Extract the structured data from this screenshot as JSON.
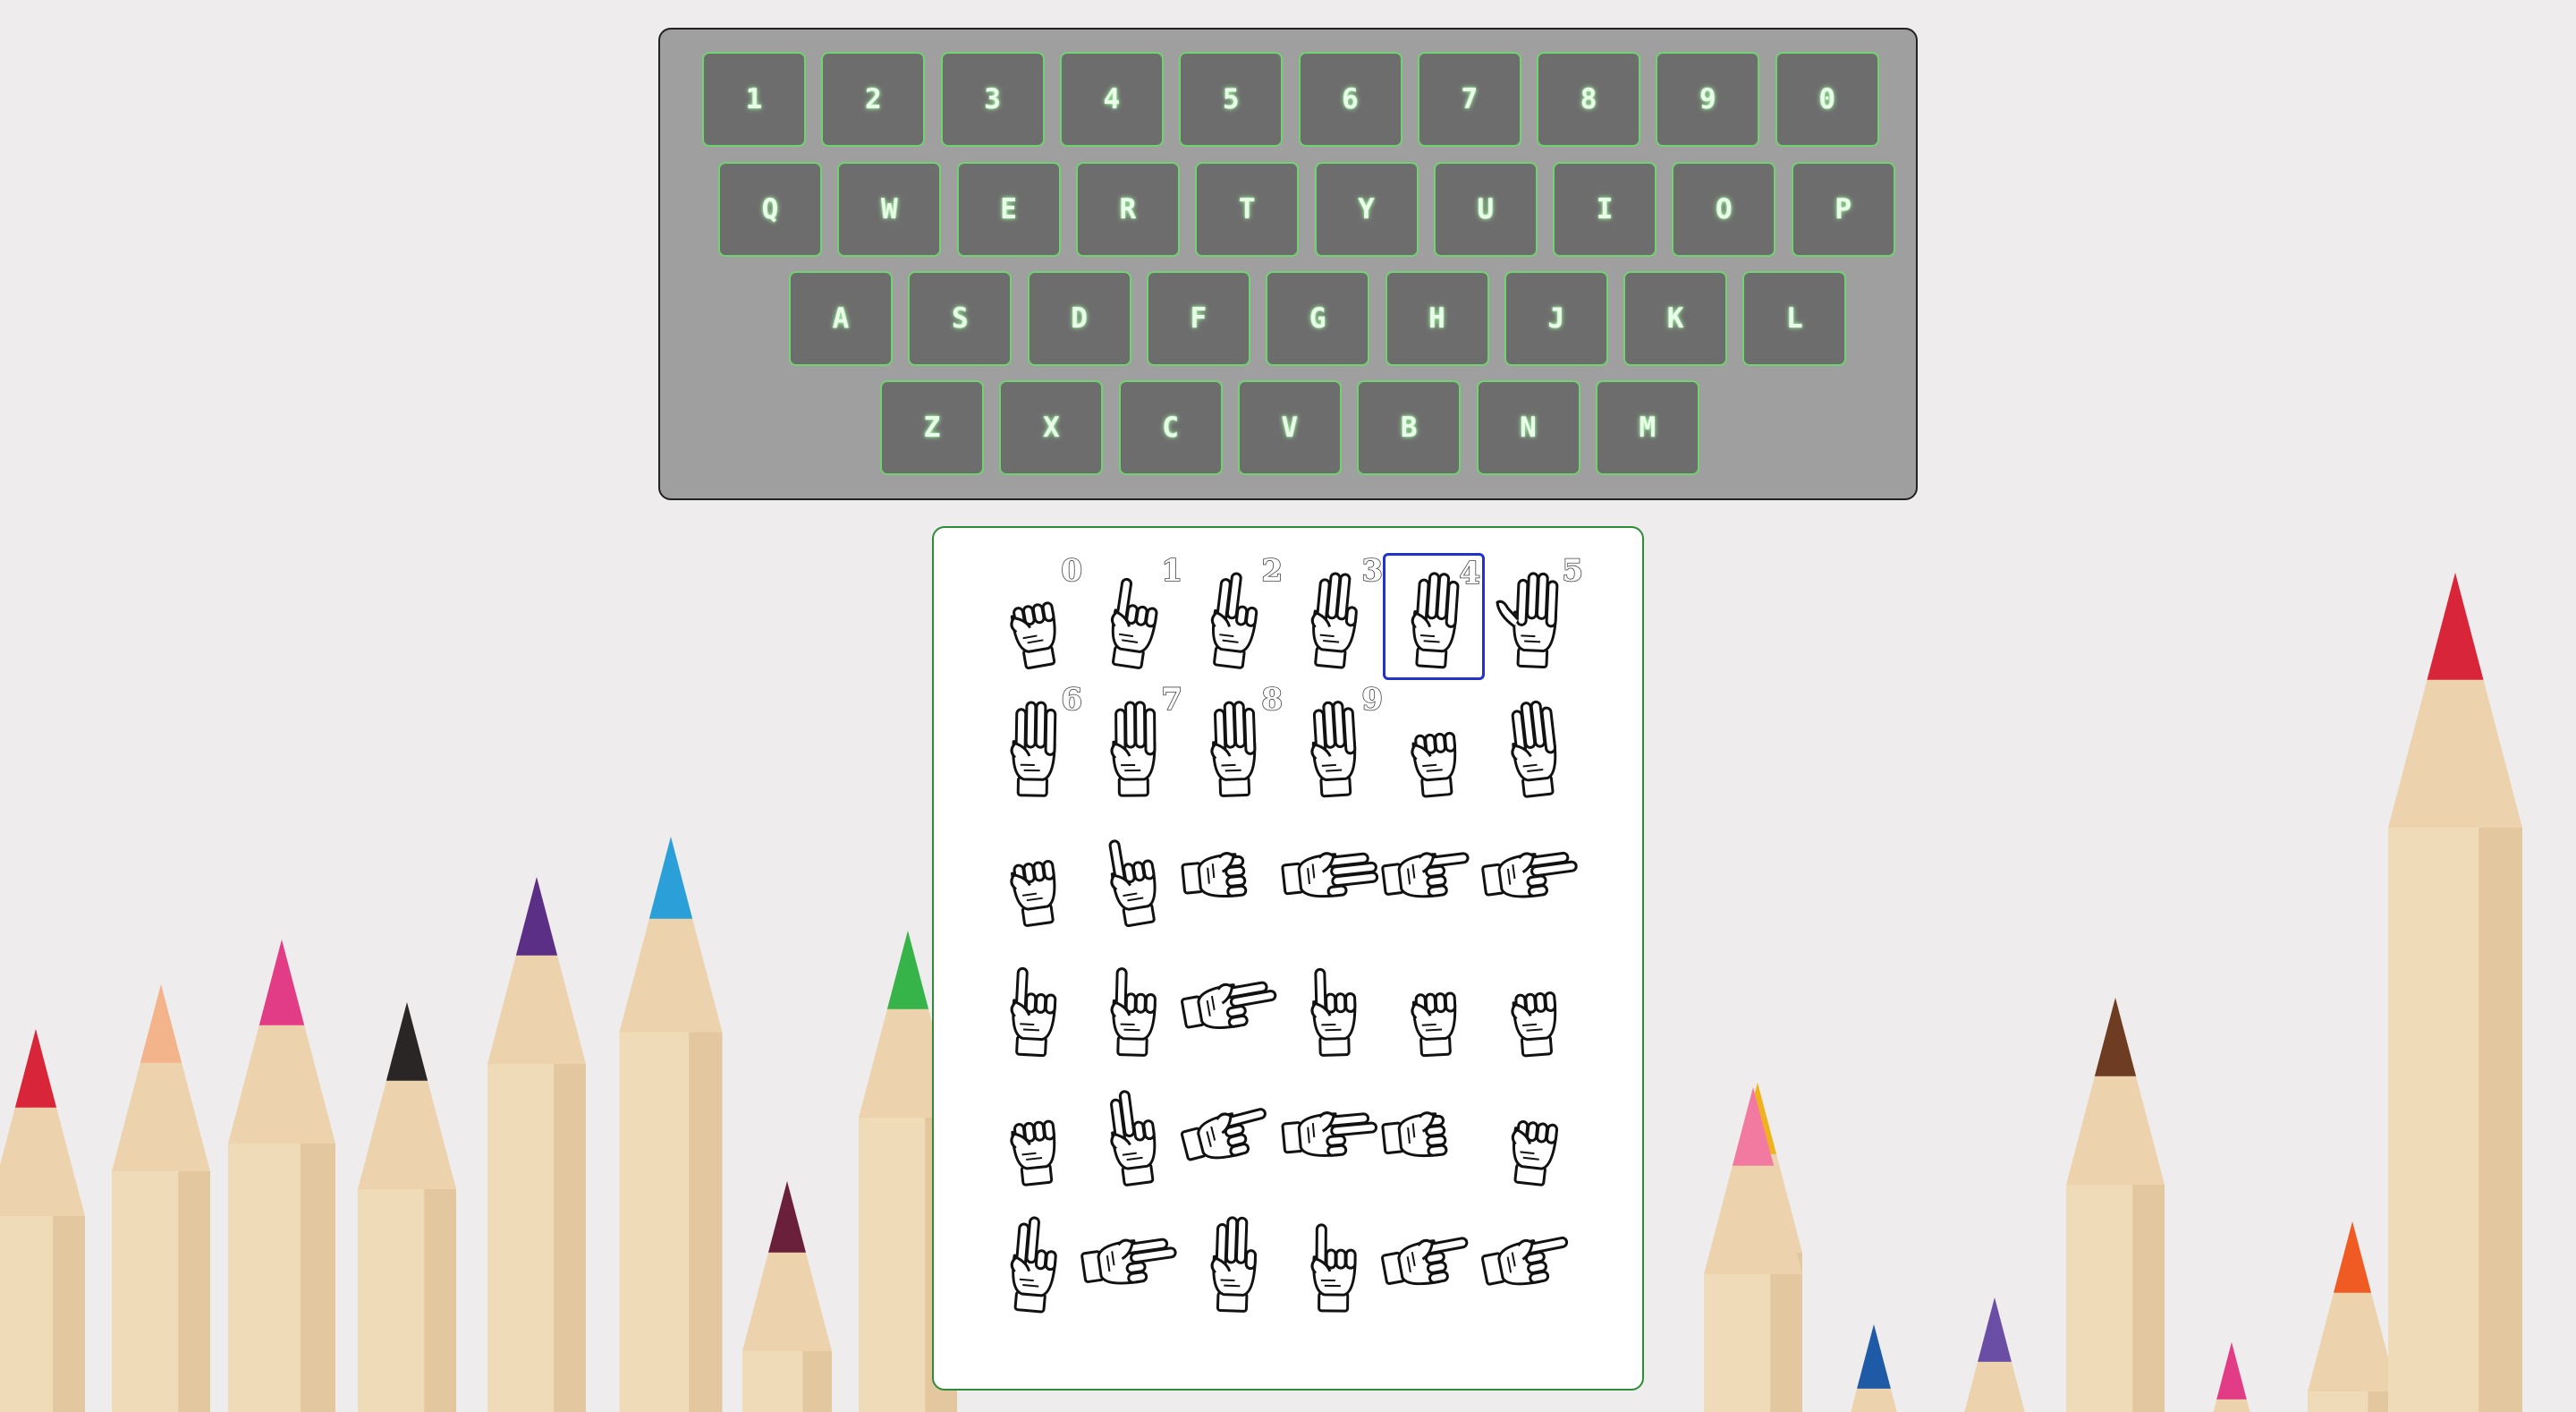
{
  "heading": {
    "text": ""
  },
  "keyboard": {
    "rows": [
      [
        "1",
        "2",
        "3",
        "4",
        "5",
        "6",
        "7",
        "8",
        "9",
        "0"
      ],
      [
        "Q",
        "W",
        "E",
        "R",
        "T",
        "Y",
        "U",
        "I",
        "O",
        "P"
      ],
      [
        "A",
        "S",
        "D",
        "F",
        "G",
        "H",
        "J",
        "K",
        "L"
      ],
      [
        "Z",
        "X",
        "C",
        "V",
        "B",
        "N",
        "M"
      ]
    ]
  },
  "signs": {
    "selected_index": 4,
    "cells": [
      {
        "sign": "0",
        "label": "0"
      },
      {
        "sign": "1",
        "label": "1"
      },
      {
        "sign": "2",
        "label": "2"
      },
      {
        "sign": "3",
        "label": "3"
      },
      {
        "sign": "4",
        "label": "4"
      },
      {
        "sign": "5",
        "label": "5"
      },
      {
        "sign": "6",
        "label": "6"
      },
      {
        "sign": "7",
        "label": "7"
      },
      {
        "sign": "8",
        "label": "8"
      },
      {
        "sign": "9",
        "label": "9"
      },
      {
        "sign": "A",
        "label": ""
      },
      {
        "sign": "B",
        "label": ""
      },
      {
        "sign": "C",
        "label": ""
      },
      {
        "sign": "D",
        "label": ""
      },
      {
        "sign": "E",
        "label": ""
      },
      {
        "sign": "F",
        "label": ""
      },
      {
        "sign": "G",
        "label": ""
      },
      {
        "sign": "H",
        "label": ""
      },
      {
        "sign": "I",
        "label": ""
      },
      {
        "sign": "J",
        "label": ""
      },
      {
        "sign": "K",
        "label": ""
      },
      {
        "sign": "L",
        "label": ""
      },
      {
        "sign": "M",
        "label": ""
      },
      {
        "sign": "N",
        "label": ""
      },
      {
        "sign": "O",
        "label": ""
      },
      {
        "sign": "P",
        "label": ""
      },
      {
        "sign": "Q",
        "label": ""
      },
      {
        "sign": "R",
        "label": ""
      },
      {
        "sign": "S",
        "label": ""
      },
      {
        "sign": "T",
        "label": ""
      },
      {
        "sign": "U",
        "label": ""
      },
      {
        "sign": "V",
        "label": ""
      },
      {
        "sign": "W",
        "label": ""
      },
      {
        "sign": "X",
        "label": ""
      },
      {
        "sign": "Y",
        "label": ""
      },
      {
        "sign": "Z",
        "label": ""
      }
    ]
  },
  "colors": {
    "key_glow": "#6fd36f",
    "panel_border": "#2e8b3a",
    "selected_border": "#2233cc"
  }
}
